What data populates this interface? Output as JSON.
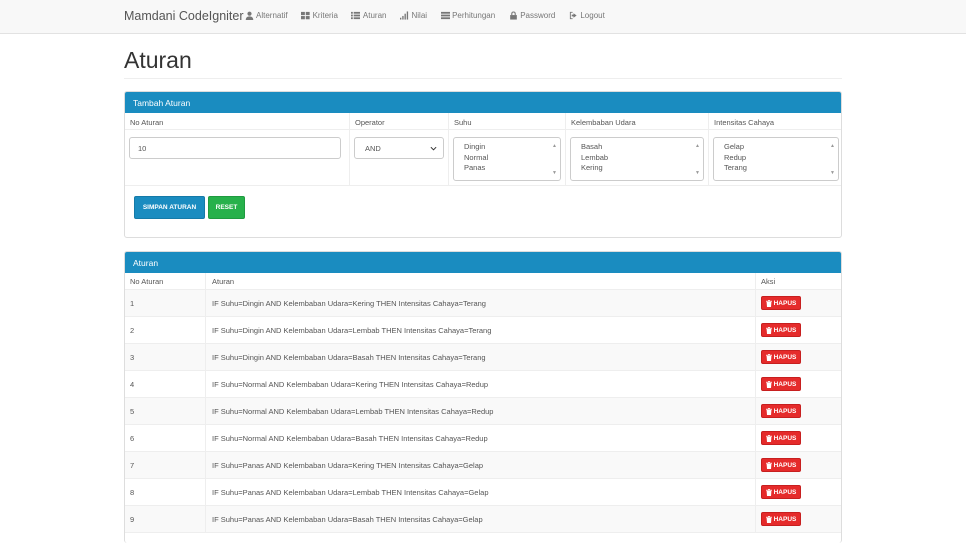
{
  "navbar": {
    "brand": "Mamdani CodeIgniter",
    "items": [
      {
        "label": "Alternatif",
        "icon": "user-icon"
      },
      {
        "label": "Kriteria",
        "icon": "th-large-icon"
      },
      {
        "label": "Aturan",
        "icon": "list-icon"
      },
      {
        "label": "Nilai",
        "icon": "signal-icon"
      },
      {
        "label": "Perhitungan",
        "icon": "th-list-icon"
      },
      {
        "label": "Password",
        "icon": "lock-icon"
      },
      {
        "label": "Logout",
        "icon": "log-out-icon"
      }
    ]
  },
  "page": {
    "title": "Aturan"
  },
  "form_panel": {
    "title": "Tambah Aturan",
    "headers": [
      "No Aturan",
      "Operator",
      "Suhu",
      "Kelembaban Udara",
      "Intensitas Cahaya"
    ],
    "no_aturan_value": "10",
    "operator_value": "AND",
    "suhu_options": [
      "Dingin",
      "Normal",
      "Panas"
    ],
    "kelembaban_options": [
      "Basah",
      "Lembab",
      "Kering"
    ],
    "intensitas_options": [
      "Gelap",
      "Redup",
      "Terang"
    ],
    "save_label": "SIMPAN ATURAN",
    "reset_label": "RESET"
  },
  "list_panel": {
    "title": "Aturan",
    "headers": [
      "No Aturan",
      "Aturan",
      "Aksi"
    ],
    "delete_label": "HAPUS",
    "rows": [
      {
        "no": "1",
        "rule": "IF Suhu=Dingin AND Kelembaban Udara=Kering THEN Intensitas Cahaya=Terang"
      },
      {
        "no": "2",
        "rule": "IF Suhu=Dingin AND Kelembaban Udara=Lembab THEN Intensitas Cahaya=Terang"
      },
      {
        "no": "3",
        "rule": "IF Suhu=Dingin AND Kelembaban Udara=Basah THEN Intensitas Cahaya=Terang"
      },
      {
        "no": "4",
        "rule": "IF Suhu=Normal AND Kelembaban Udara=Kering THEN Intensitas Cahaya=Redup"
      },
      {
        "no": "5",
        "rule": "IF Suhu=Normal AND Kelembaban Udara=Lembab THEN Intensitas Cahaya=Redup"
      },
      {
        "no": "6",
        "rule": "IF Suhu=Normal AND Kelembaban Udara=Basah THEN Intensitas Cahaya=Redup"
      },
      {
        "no": "7",
        "rule": "IF Suhu=Panas AND Kelembaban Udara=Kering THEN Intensitas Cahaya=Gelap"
      },
      {
        "no": "8",
        "rule": "IF Suhu=Panas AND Kelembaban Udara=Lembab THEN Intensitas Cahaya=Gelap"
      },
      {
        "no": "9",
        "rule": "IF Suhu=Panas AND Kelembaban Udara=Basah THEN Intensitas Cahaya=Gelap"
      }
    ]
  },
  "colors": {
    "primary": "#1a8cc0",
    "success": "#27b14b",
    "danger": "#e52b2b"
  }
}
